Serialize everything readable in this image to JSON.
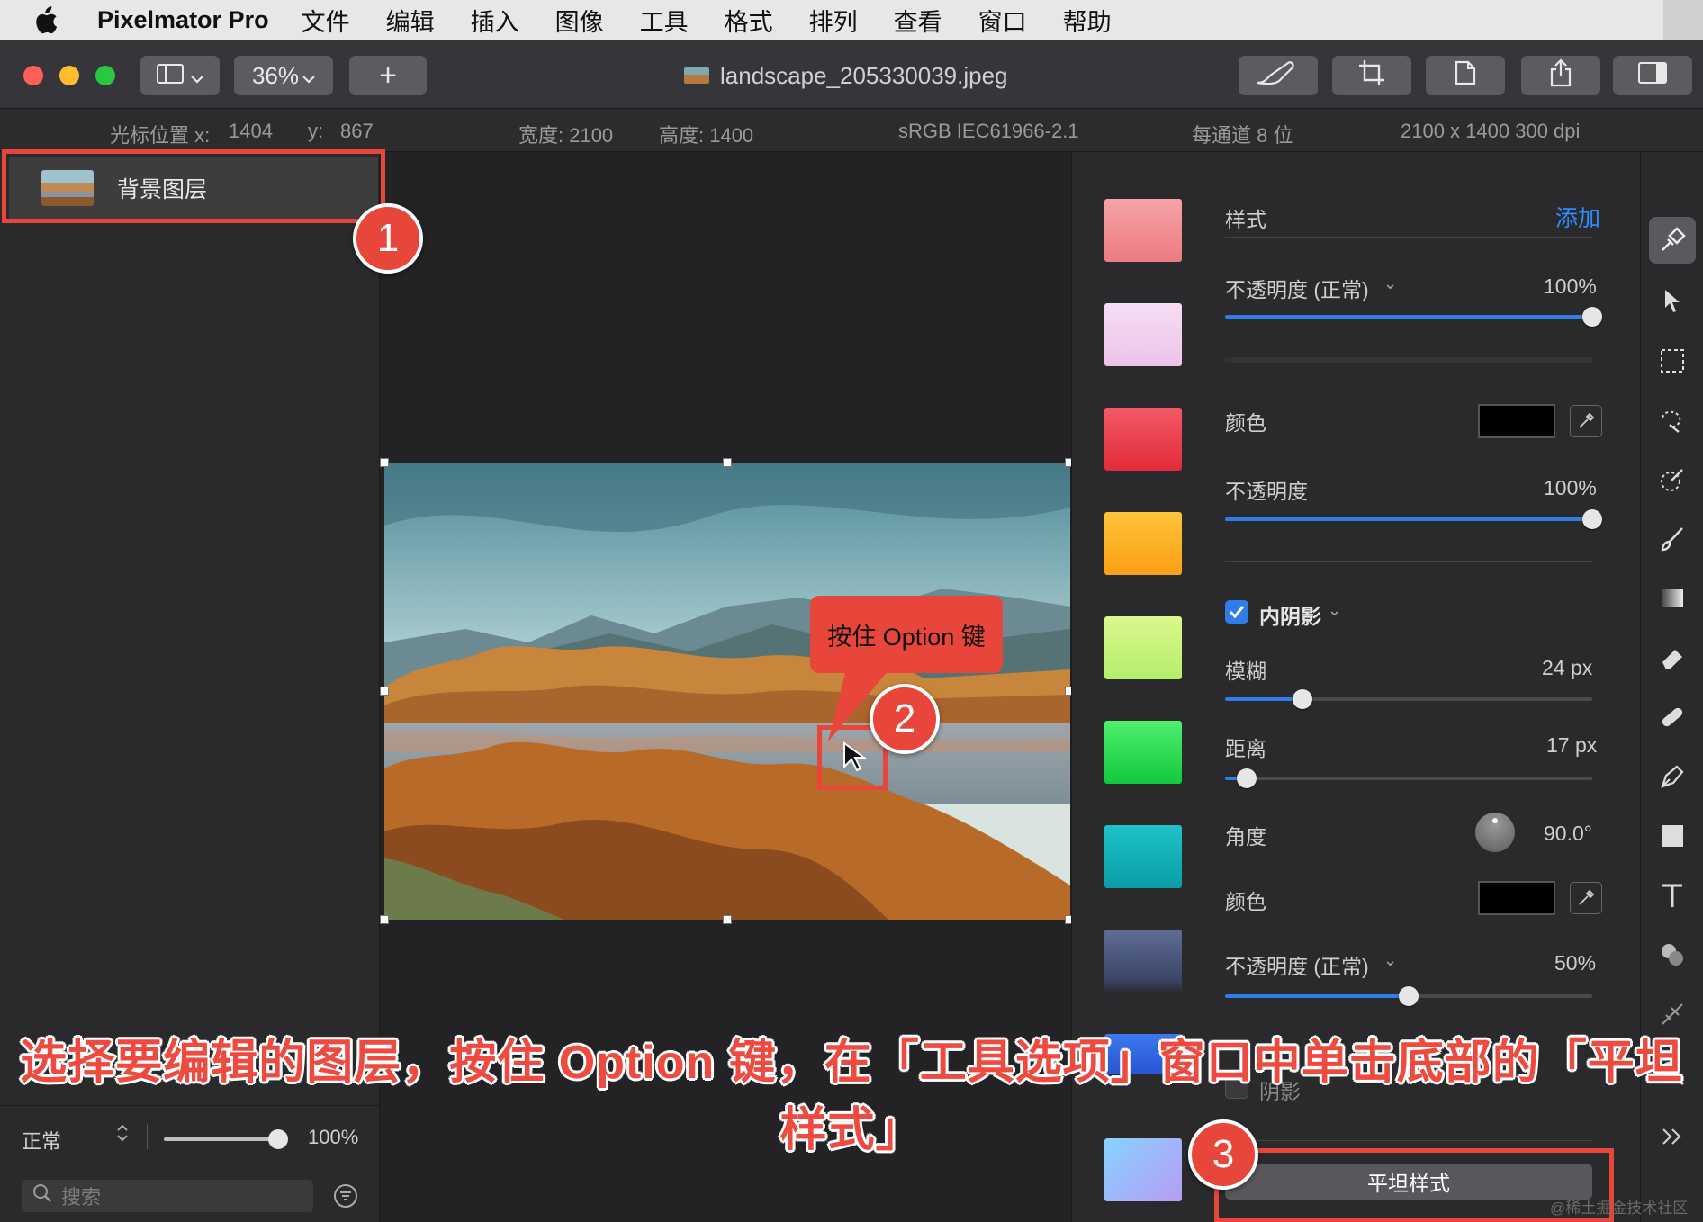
{
  "menubar": {
    "app_name": "Pixelmator Pro",
    "items": [
      "文件",
      "编辑",
      "插入",
      "图像",
      "工具",
      "格式",
      "排列",
      "查看",
      "窗口",
      "帮助"
    ]
  },
  "toolbar": {
    "zoom": "36%",
    "add_label": "+",
    "document_title": "landscape_205330039.jpeg"
  },
  "infobar": {
    "cursor_label": "光标位置 x:",
    "cursor_x": "1404",
    "cursor_y_label": "y:",
    "cursor_y": "867",
    "width": "宽度: 2100",
    "height": "高度: 1400",
    "color_profile": "sRGB IEC61966-2.1",
    "bit_depth": "每通道 8 位",
    "dimensions": "2100 x 1400 300 dpi"
  },
  "layers": {
    "items": [
      {
        "label": "背景图层"
      }
    ],
    "blend_mode": "正常",
    "opacity": "100%",
    "opacity_fraction": 1.0,
    "search_placeholder": "搜索"
  },
  "inspector": {
    "style_label": "样式",
    "add_label": "添加",
    "fill_opacity_label": "不透明度 (正常)",
    "fill_opacity_value": "100%",
    "fill_opacity_fraction": 1.0,
    "color_label": "颜色",
    "opacity_label": "不透明度",
    "opacity_value": "100%",
    "opacity_fraction": 1.0,
    "inner_shadow": {
      "label": "内阴影",
      "checked": true,
      "blur_label": "模糊",
      "blur_value": "24 px",
      "blur_fraction": 0.21,
      "distance_label": "距离",
      "distance_value": "17 px",
      "distance_fraction": 0.06,
      "angle_label": "角度",
      "angle_value": "90.0°",
      "color_label": "颜色",
      "opacity_label": "不透明度 (正常)",
      "opacity_value": "50%",
      "opacity_fraction": 0.5
    },
    "shadow_label": "阴影",
    "flat_style_button": "平坦样式",
    "swatch_colors": [
      "#f08a8f",
      "#f3d0ec",
      "#ee3f4e",
      "#fdb228",
      "#c6f47c",
      "#2dde56",
      "#13b3b8",
      "#4e5c83",
      "#2f5fdc",
      "#9fb0ff"
    ]
  },
  "annotations": {
    "callout": "按住 Option 键",
    "badges": [
      "1",
      "2",
      "3"
    ],
    "caption": "选择要编辑的图层，按住 Option 键，在「工具选项」窗口中单击底部的「平坦样式」",
    "watermark": "@稀土掘金技术社区"
  }
}
